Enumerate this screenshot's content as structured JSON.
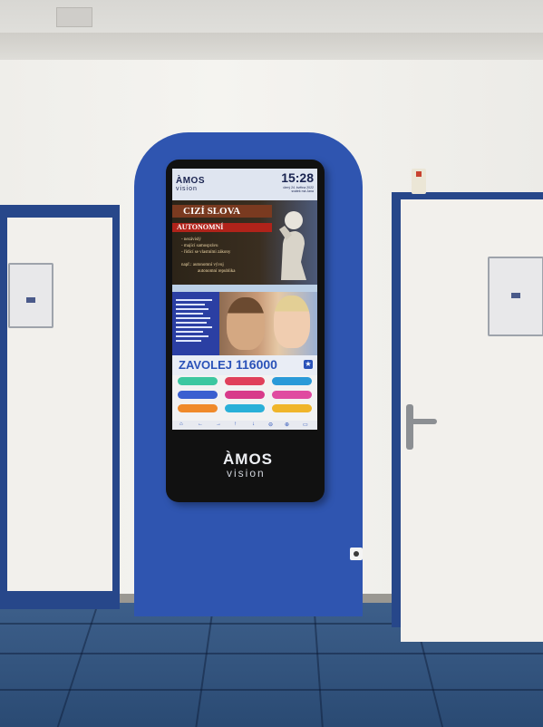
{
  "kiosk": {
    "brand": "ÀMOS",
    "brand_sub": "vision",
    "clock": "15:28",
    "date_line_1": "úterý 24. května 2022",
    "date_line_2": "svátek má Jana",
    "headline": "CIZÍ SLOVA",
    "word": "AUTONOMNÍ",
    "definitions": [
      "- nezávislý",
      "- mající samosprávu",
      "- řídící se vlastními zákony"
    ],
    "example_1": "např.: autonomní vývoj",
    "example_2": "autonomní republika",
    "call_label": "ZAVOLEJ",
    "call_number": "116000",
    "bezel_brand": "ÀMOS",
    "bezel_sub": "vision"
  },
  "colors": {
    "panel": "#2f55b0",
    "door_frame": "#27478a",
    "floor": "#2f4f7a"
  }
}
